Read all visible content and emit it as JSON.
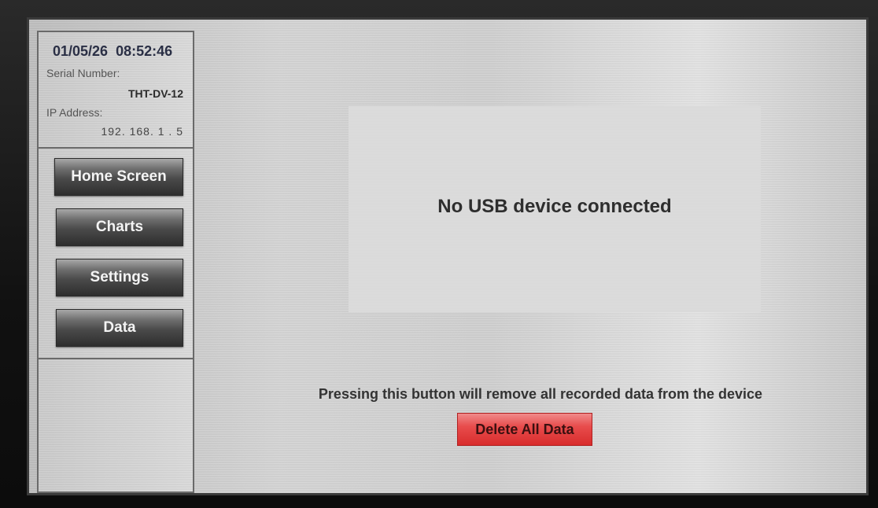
{
  "status": {
    "date": "01/05/26",
    "time": "08:52:46",
    "serial_label": "Serial Number:",
    "serial_value": "THT-DV-12",
    "ip_label": "IP Address:",
    "ip_value": "192. 168. 1 . 5"
  },
  "nav": {
    "items": [
      {
        "label": "Home Screen"
      },
      {
        "label": "Charts"
      },
      {
        "label": "Settings"
      },
      {
        "label": "Data"
      }
    ]
  },
  "main": {
    "usb_message": "No USB device connected",
    "warning": "Pressing this button will remove all recorded data from the device",
    "delete_label": "Delete All Data"
  },
  "colors": {
    "delete_button": "#e84d4d",
    "nav_button": "#4a4a4a",
    "screen_background": "#d0d0d0"
  }
}
